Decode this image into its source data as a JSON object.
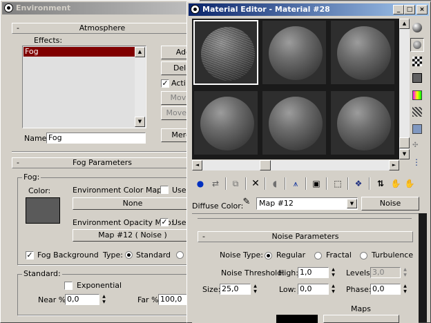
{
  "environment_window": {
    "title": "Environment",
    "atmosphere": {
      "header": "Atmosphere",
      "collapse_symbol": "-",
      "effects_label": "Effects:",
      "effects_list": [
        "Fog"
      ],
      "add_label": "Add",
      "delete_label": "Dele",
      "active_label": "Acti",
      "active_checked": true,
      "move_up_label": "Move",
      "move_down_label": "Move D",
      "merge_label": "Merg",
      "name_label": "Name:",
      "name_value": "Fog"
    },
    "fog_parameters": {
      "header": "Fog Parameters",
      "collapse_symbol": "-",
      "fog_group": "Fog:",
      "color_label": "Color:",
      "color_swatch": "#5a5a5a",
      "env_color_map_label": "Environment Color Map:",
      "env_color_use_label": "Use",
      "env_color_map_button": "None",
      "env_opacity_map_label": "Environment Opacity Map:",
      "env_opacity_use_label": "Use",
      "env_opacity_use_checked": true,
      "env_opacity_map_button": "Map #12  ( Noise )",
      "fog_background_label": "Fog Background",
      "fog_background_checked": true,
      "type_label": "Type:",
      "type_standard_label": "Standard",
      "standard_group": "Standard:",
      "exponential_label": "Exponential",
      "near_label": "Near %:",
      "near_value": "0,0",
      "far_label": "Far %:",
      "far_value": "100,0"
    }
  },
  "material_editor": {
    "title": "Material Editor - Material #28",
    "window_buttons": {
      "minimize": "_",
      "maximize": "□",
      "close": "×"
    },
    "diffuse_color_label": "Diffuse Color:",
    "map_dropdown_value": "Map #12",
    "map_type_button": "Noise",
    "noise_parameters": {
      "header": "Noise Parameters",
      "collapse_symbol": "-",
      "noise_type_label": "Noise Type:",
      "regular_label": "Regular",
      "fractal_label": "Fractal",
      "turbulence_label": "Turbulence",
      "noise_threshold_label": "Noise Threshold:",
      "high_label": "High:",
      "high_value": "1,0",
      "levels_label": "Levels:",
      "levels_value": "3,0",
      "size_label": "Size:",
      "size_value": "25,0",
      "low_label": "Low:",
      "low_value": "0,0",
      "phase_label": "Phase:",
      "phase_value": "0,0",
      "maps_label": "Maps"
    },
    "side_tools": [
      "sample-type-sphere-icon",
      "backlight-icon",
      "background-checker-icon",
      "sample-uv-tiling-icon",
      "video-color-check-icon",
      "make-preview-icon",
      "options-icon",
      "select-by-material-icon",
      "material-map-navigator-icon"
    ],
    "bottom_tools": [
      "get-material-icon",
      "put-to-scene-icon",
      "assign-to-selection-icon",
      "reset-map-icon",
      "make-unique-icon",
      "put-to-library-icon",
      "material-effects-channel-icon",
      "show-map-in-viewport-icon",
      "show-end-result-icon",
      "go-to-parent-icon",
      "go-forward-to-sibling-icon",
      "pick-material-icon"
    ]
  }
}
